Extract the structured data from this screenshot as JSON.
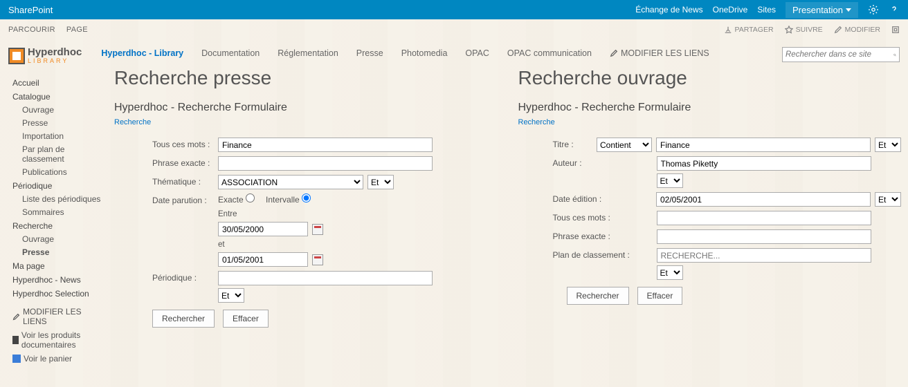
{
  "suite": {
    "brand": "SharePoint",
    "links": {
      "echange": "Échange de News",
      "onedrive": "OneDrive",
      "sites": "Sites"
    },
    "presentation": "Presentation"
  },
  "ribbon": {
    "tabs": {
      "browse": "PARCOURIR",
      "page": "PAGE"
    },
    "actions": {
      "partager": "PARTAGER",
      "suivre": "SUIVRE",
      "modifier": "MODIFIER"
    }
  },
  "logo": {
    "name": "Hyperdhoc",
    "sub": "LIBRARY"
  },
  "topnav": {
    "items": [
      {
        "label": "Hyperdhoc - Library",
        "active": true
      },
      {
        "label": "Documentation"
      },
      {
        "label": "Réglementation"
      },
      {
        "label": "Presse"
      },
      {
        "label": "Photomedia"
      },
      {
        "label": "OPAC"
      },
      {
        "label": "OPAC communication"
      }
    ],
    "edit": "MODIFIER LES LIENS"
  },
  "search": {
    "placeholder": "Rechercher dans ce site"
  },
  "leftnav": {
    "accueil": "Accueil",
    "catalogue": "Catalogue",
    "catalogue_items": [
      "Ouvrage",
      "Presse",
      "Importation",
      "Par plan de classement",
      "Publications"
    ],
    "periodique": "Périodique",
    "periodique_items": [
      "Liste des périodiques",
      "Sommaires"
    ],
    "recherche": "Recherche",
    "recherche_items": [
      {
        "label": "Ouvrage",
        "bold": false
      },
      {
        "label": "Presse",
        "bold": true
      }
    ],
    "mapage": "Ma page",
    "news": "Hyperdhoc - News",
    "selection": "Hyperdhoc Selection",
    "edit": "MODIFIER LES LIENS",
    "produits": "Voir les produits documentaires",
    "panier": "Voir le panier"
  },
  "press": {
    "title": "Recherche presse",
    "subtitle": "Hyperdhoc - Recherche Formulaire",
    "bc": "Recherche",
    "labels": {
      "tous": "Tous ces mots :",
      "phrase": "Phrase exacte :",
      "thematique": "Thématique :",
      "date": "Date parution :",
      "periodique": "Périodique :"
    },
    "values": {
      "tous": "Finance",
      "thematique": "ASSOCIATION",
      "op_them": "Et",
      "date_mode": {
        "exacte": "Exacte",
        "intervalle": "Intervalle",
        "selected": "intervalle"
      },
      "date_between": "Entre",
      "date_from": "30/05/2000",
      "date_and": "et",
      "date_to": "01/05/2001",
      "op_per": "Et"
    },
    "buttons": {
      "search": "Rechercher",
      "clear": "Effacer"
    }
  },
  "ouvrage": {
    "title": "Recherche ouvrage",
    "subtitle": "Hyperdhoc - Recherche Formulaire",
    "bc": "Recherche",
    "labels": {
      "titre": "Titre :",
      "auteur": "Auteur :",
      "edition": "Date édition :",
      "tous": "Tous ces mots :",
      "phrase": "Phrase exacte :",
      "plan": "Plan de classement :"
    },
    "values": {
      "titre_op": "Contient",
      "titre": "Finance",
      "titre_op2": "Et",
      "auteur": "Thomas Piketty",
      "auteur_op": "Et",
      "edition": "02/05/2001",
      "edition_op": "Et",
      "plan_placeholder": "RECHERCHE...",
      "plan_op": "Et"
    },
    "buttons": {
      "search": "Rechercher",
      "clear": "Effacer"
    }
  }
}
